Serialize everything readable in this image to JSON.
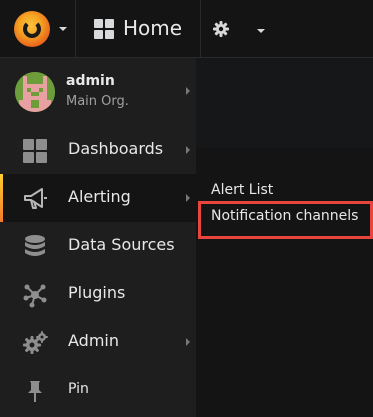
{
  "topbar": {
    "home_label": "Home"
  },
  "user": {
    "name": "admin",
    "org": "Main Org."
  },
  "menu": {
    "items": [
      {
        "label": "Dashboards",
        "icon": "dashboards-icon"
      },
      {
        "label": "Alerting",
        "icon": "alerting-icon",
        "active": true
      },
      {
        "label": "Data Sources",
        "icon": "database-icon"
      },
      {
        "label": "Plugins",
        "icon": "plugins-icon"
      },
      {
        "label": "Admin",
        "icon": "admin-gears-icon"
      },
      {
        "label": "Pin",
        "icon": "pin-icon"
      }
    ]
  },
  "submenu": {
    "items": [
      {
        "label": "Alert List"
      },
      {
        "label": "Notification channels",
        "highlighted": true
      }
    ]
  },
  "colors": {
    "accent_gradient_top": "#ffcf2e",
    "accent_gradient_bottom": "#f47a29",
    "highlight_box": "#e8453c",
    "background": "#161719",
    "sidemenu_bg": "#1e1e1e"
  }
}
